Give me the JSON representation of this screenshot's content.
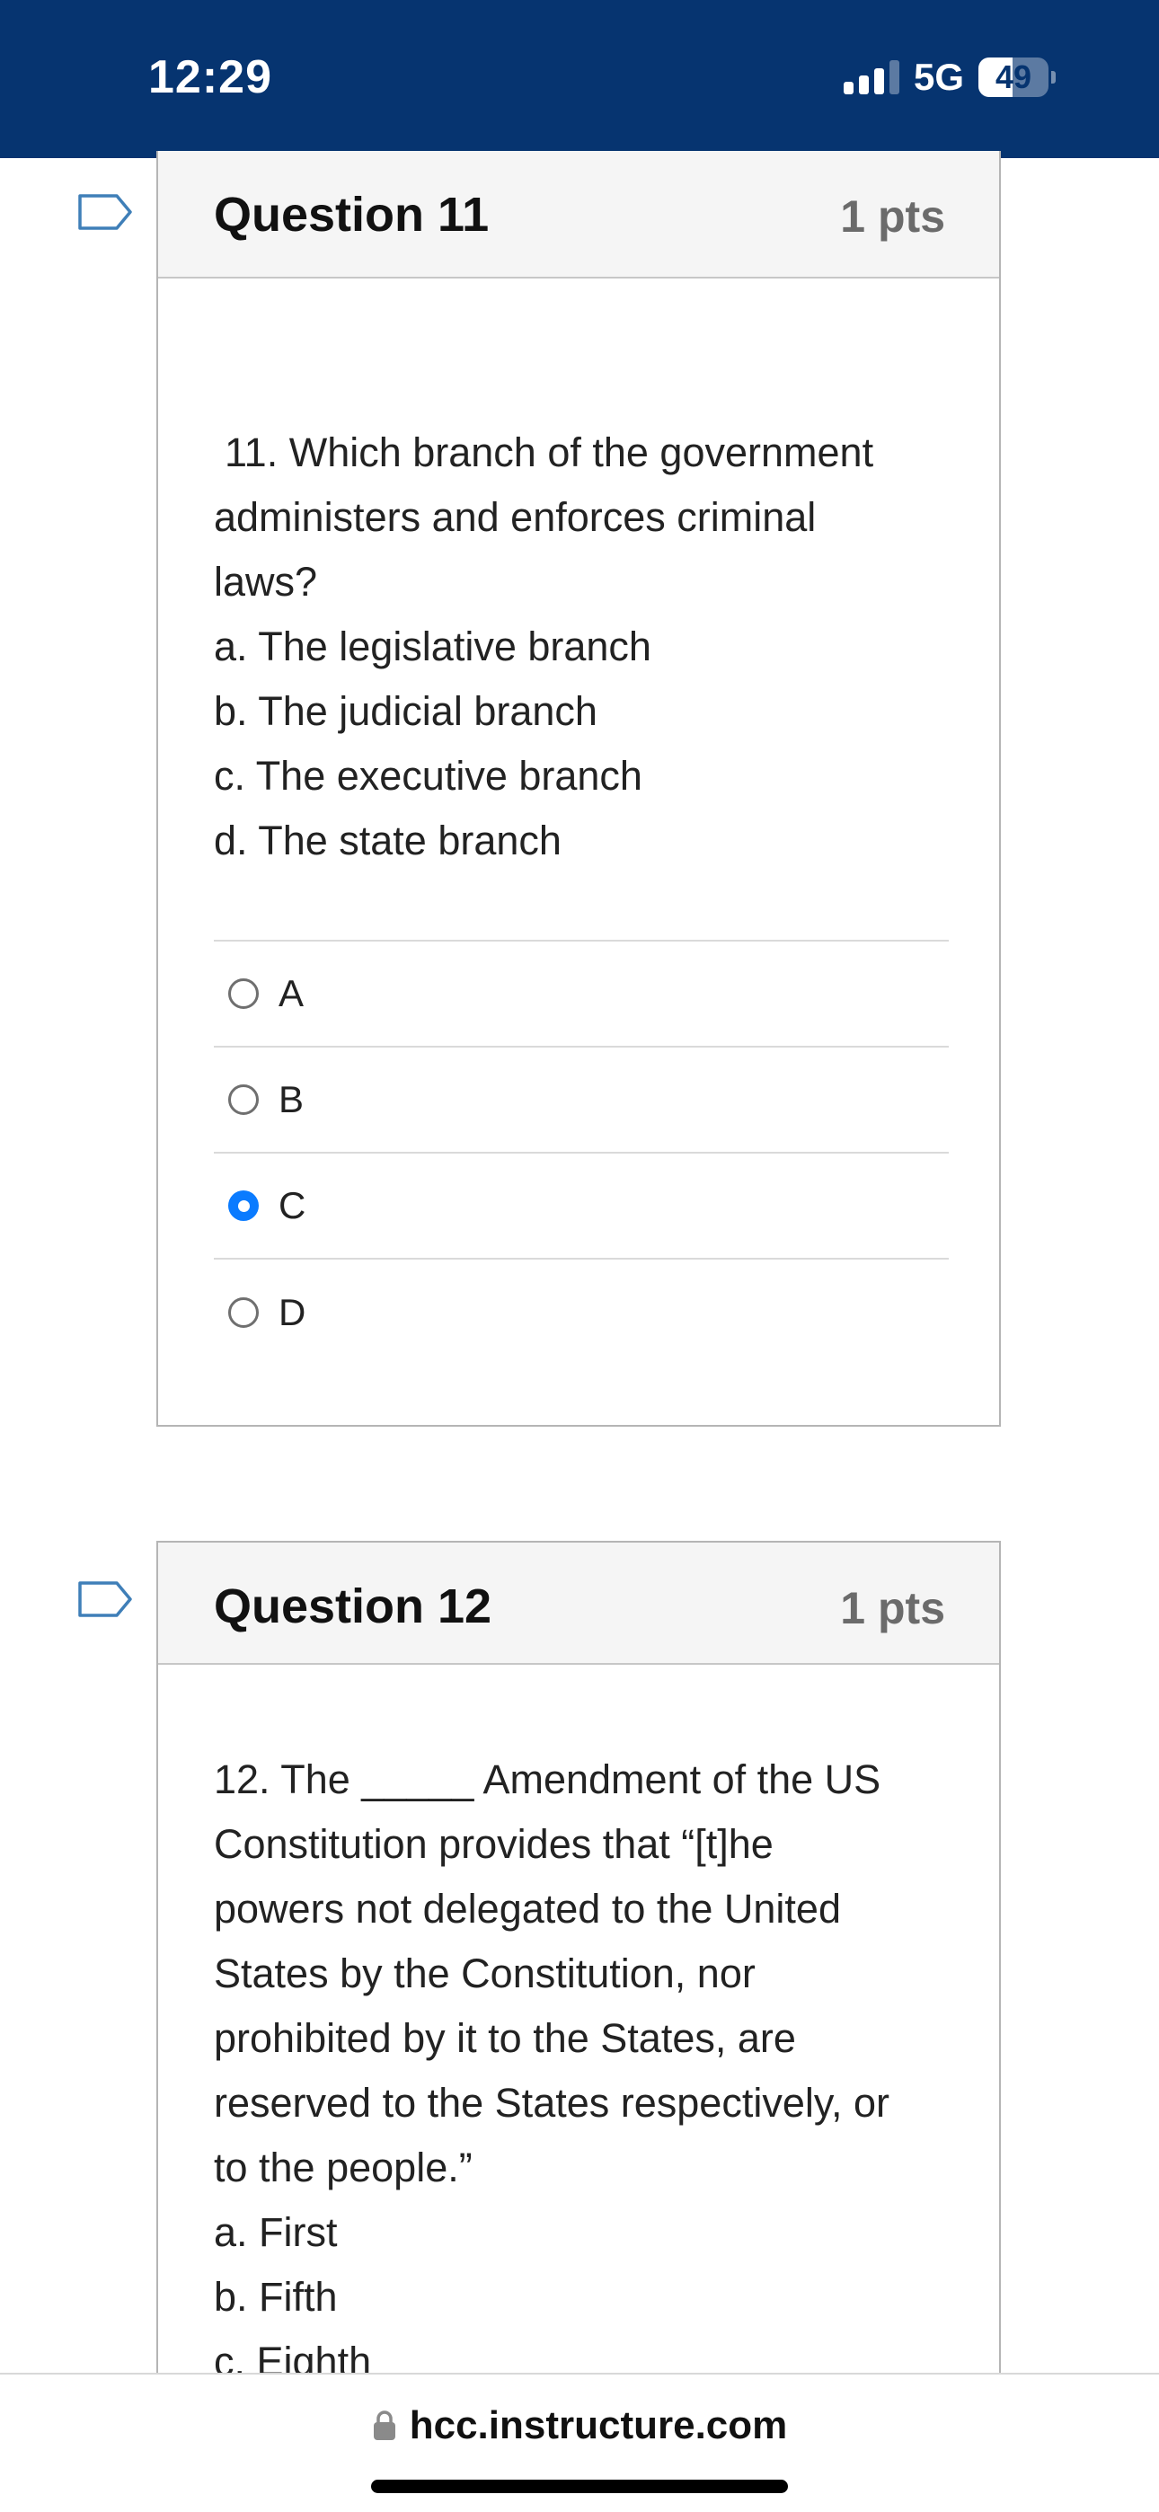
{
  "status_bar": {
    "time": "12:29",
    "network": "5G",
    "battery": "49",
    "battery_level_percent": 49
  },
  "questions": [
    {
      "title": "Question 11",
      "points": "1 pts",
      "prompt_lines": [
        "11. Which branch of the government",
        "administers and enforces criminal",
        "laws?"
      ],
      "choices": [
        "a. The legislative branch",
        "b. The judicial branch",
        "c. The executive branch",
        "d. The state branch"
      ],
      "answers": [
        {
          "label": "A",
          "selected": false
        },
        {
          "label": "B",
          "selected": false
        },
        {
          "label": "C",
          "selected": true
        },
        {
          "label": "D",
          "selected": false
        }
      ]
    },
    {
      "title": "Question 12",
      "points": "1 pts",
      "prompt_lines": [
        "12. The _____ Amendment of the US",
        "Constitution provides that “[t]he",
        "powers not delegated to the United",
        "States by the Constitution, nor",
        "prohibited by it to the States, are",
        "reserved to the States respectively, or",
        "to the people.”"
      ],
      "choices": [
        "a. First",
        "b. Fifth",
        "c. Eighth"
      ]
    }
  ],
  "url_bar": {
    "url": "hcc.instructure.com",
    "icon": "lock-icon"
  },
  "colors": {
    "status_bar_bg": "#063470",
    "radio_selected": "#0a7bff",
    "flag_stroke": "#3f7fb8"
  }
}
